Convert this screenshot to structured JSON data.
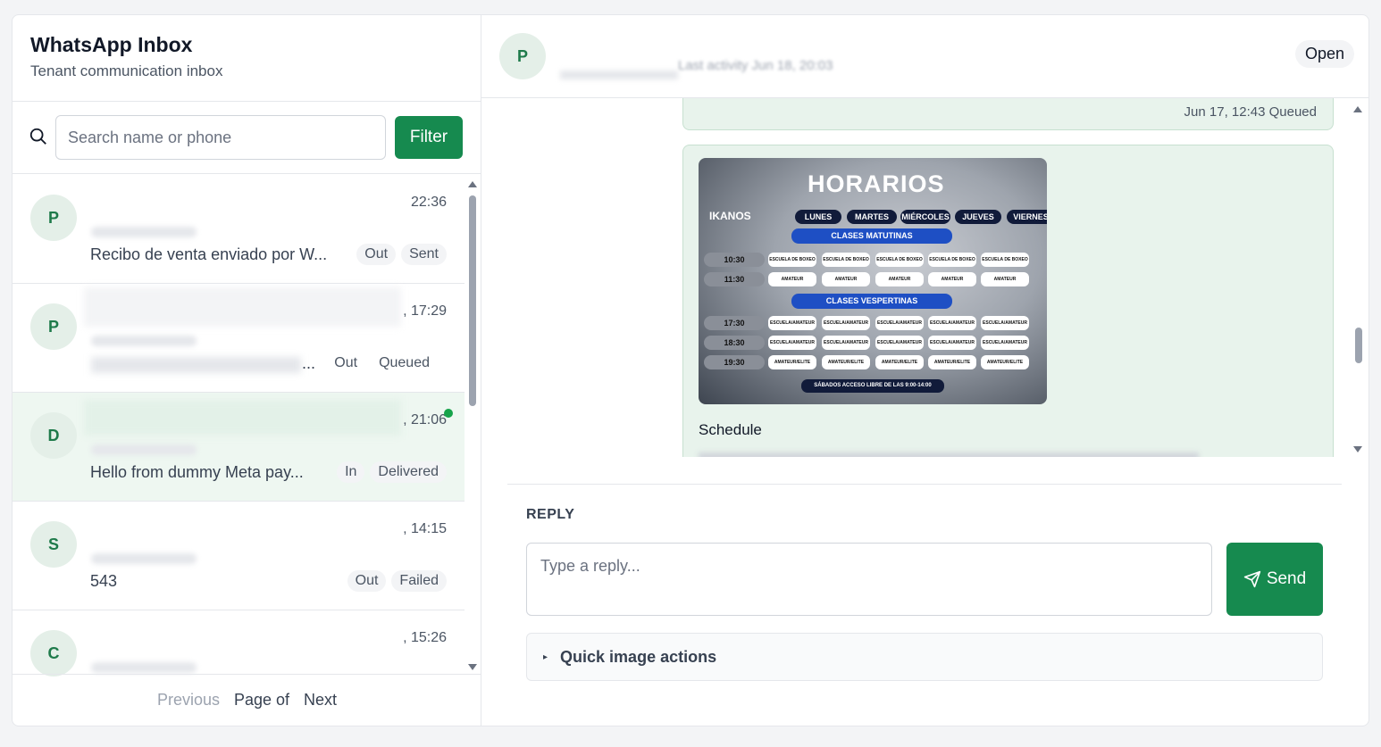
{
  "inbox": {
    "title": "WhatsApp Inbox",
    "subtitle": "Tenant communication inbox",
    "search_placeholder": "Search name or phone",
    "filter_label": "Filter"
  },
  "conversations": [
    {
      "initial": "P",
      "time": "22:36",
      "preview": "Recibo de venta enviado por W...",
      "direction": "Out",
      "status": "Sent"
    },
    {
      "initial": "P",
      "time": ", 17:29",
      "preview": "...",
      "direction": "Out",
      "status": "Queued"
    },
    {
      "initial": "D",
      "time": ", 21:06",
      "preview": "Hello from dummy Meta pay...",
      "direction": "In",
      "status": "Delivered"
    },
    {
      "initial": "S",
      "time": ", 14:15",
      "preview": "543",
      "direction": "Out",
      "status": "Failed"
    },
    {
      "initial": "C",
      "time": ", 15:26",
      "preview": "",
      "direction": "",
      "status": ""
    }
  ],
  "pager": {
    "prev": "Previous",
    "page": "Page of",
    "next": "Next"
  },
  "chat": {
    "avatar_initial": "P",
    "subtitle": "Last activity Jun 18, 20:03",
    "status": "Open",
    "prev_message_meta": "Jun 17, 12:43  Queued",
    "image": {
      "title": "HORARIOS",
      "logo": "IKANOS",
      "days": [
        "LUNES",
        "MARTES",
        "MIÉRCOLES",
        "JUEVES",
        "VIERNES"
      ],
      "morning_band": "CLASES MATUTINAS",
      "evening_band": "CLASES VESPERTINAS",
      "morning_times": [
        "10:30",
        "11:30"
      ],
      "evening_times": [
        "17:30",
        "18:30",
        "19:30"
      ],
      "cells": {
        "r1030": "ESCUELA DE BOXEO",
        "r1130": "AMATEUR",
        "r1730": "ESCUELA/AMATEUR",
        "r1830": "ESCUELA/AMATEUR",
        "r1930": "AMATEUR/ELITE"
      },
      "footer": "SÁBADOS ACCESO LIBRE DE LAS 9:00-14:00"
    },
    "caption": "Schedule"
  },
  "reply": {
    "label": "REPLY",
    "placeholder": "Type a reply...",
    "send_label": "Send",
    "quick_actions_label": "Quick image actions"
  },
  "colors": {
    "brand": "#168a4f",
    "selected_row": "#eef7f1",
    "message_bg": "#e8f3ec"
  }
}
